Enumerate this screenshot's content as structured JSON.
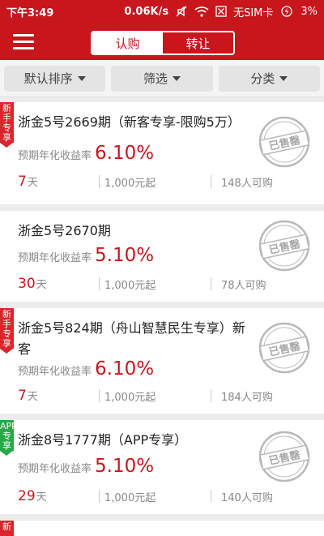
{
  "status": {
    "time": "下午3:49",
    "speed": "0.06K/s",
    "carrier": "无SIM卡",
    "battery": "3%"
  },
  "header": {
    "tabs": [
      {
        "label": "认购",
        "active": true
      },
      {
        "label": "转让",
        "active": false
      }
    ]
  },
  "filters": [
    {
      "label": "默认排序"
    },
    {
      "label": "筛选"
    },
    {
      "label": "分类"
    }
  ],
  "products": [
    {
      "title": "浙金5号2669期（新客专享-限购5万）",
      "tag": "新手专享",
      "rate_label": "预期年化收益率",
      "rate": "6.10%",
      "days": "7",
      "days_unit": "天",
      "min": "1,000元起",
      "buyers": "148人可购",
      "stamp": "已售罄"
    },
    {
      "title": "浙金5号2670期",
      "tag": "",
      "rate_label": "预期年化收益率",
      "rate": "5.10%",
      "days": "30",
      "days_unit": "天",
      "min": "1,000元起",
      "buyers": "78人可购",
      "stamp": "已售罄"
    },
    {
      "title": "浙金5号824期（舟山智慧民生专享）新客",
      "tag": "新手专享",
      "rate_label": "预期年化收益率",
      "rate": "6.10%",
      "days": "7",
      "days_unit": "天",
      "min": "1,000元起",
      "buyers": "184人可购",
      "stamp": "已售罄"
    },
    {
      "title": "浙金8号1777期（APP专享）",
      "tag": "APP专享",
      "rate_label": "预期年化收益率",
      "rate": "5.10%",
      "days": "29",
      "days_unit": "天",
      "min": "1,000元起",
      "buyers": "140人可购",
      "stamp": "已售罄"
    }
  ],
  "partial_tag": "新",
  "colors": {
    "brand": "#c8161d",
    "tag_red": "#d9252b",
    "tag_green": "#29a847"
  }
}
